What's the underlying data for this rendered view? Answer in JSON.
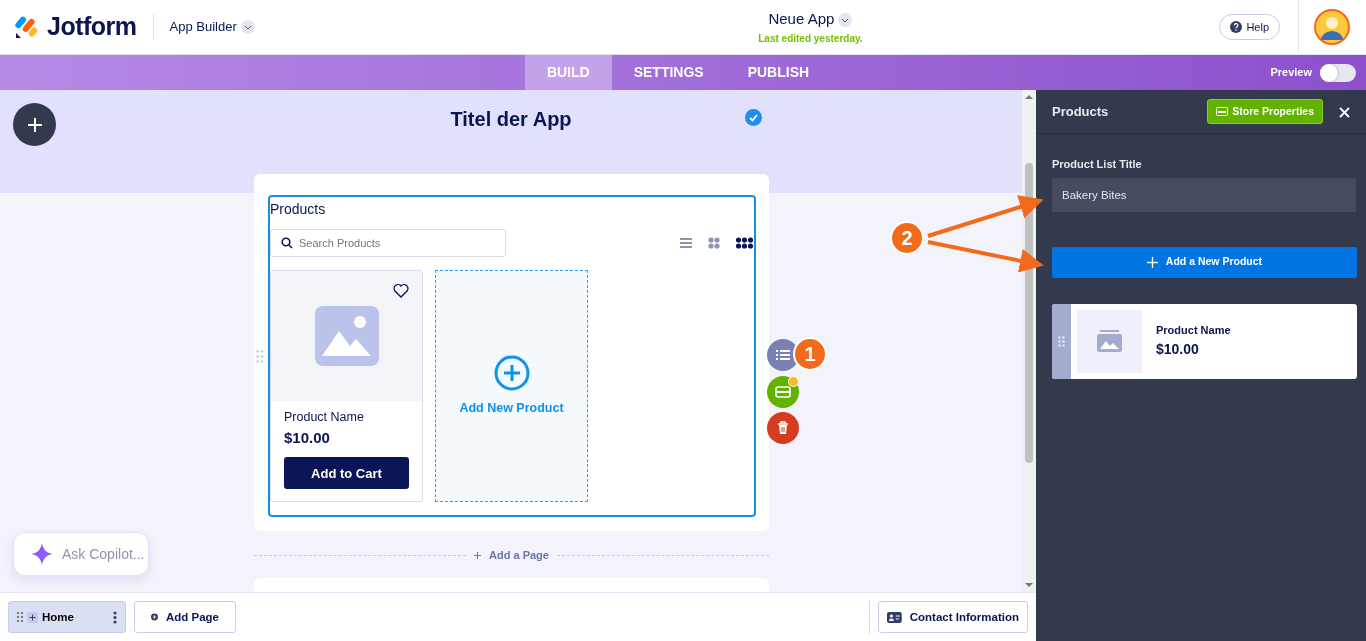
{
  "header": {
    "brand": "Jotform",
    "product_menu": "App Builder",
    "app_name": "Neue App",
    "last_edited": "Last edited yesterday.",
    "help": "Help"
  },
  "tabs": [
    {
      "label": "BUILD",
      "selected": true
    },
    {
      "label": "SETTINGS",
      "selected": false
    },
    {
      "label": "PUBLISH",
      "selected": false
    }
  ],
  "preview": {
    "label": "Preview",
    "on": false
  },
  "app": {
    "title": "Titel der App"
  },
  "product_list": {
    "title": "Products",
    "search_placeholder": "Search Products",
    "view_modes": [
      {
        "kind": "list",
        "selected": false
      },
      {
        "kind": "grid2",
        "selected": false
      },
      {
        "kind": "grid3",
        "selected": true
      }
    ],
    "products": [
      {
        "name": "Product Name",
        "price": "$10.00",
        "button": "Add to Cart",
        "favorite": false
      }
    ],
    "add_product": "Add New Product"
  },
  "add_page_divider": "Add a Page",
  "copilot": {
    "placeholder": "Ask Copilot..."
  },
  "pages": [
    {
      "label": "Home",
      "selected": true
    }
  ],
  "add_page": "Add Page",
  "contact_button": "Contact Information",
  "panel": {
    "title": "Products",
    "store_button": "Store Properties",
    "field_label": "Product List Title",
    "field_value": "Bakery Bites",
    "add_button": "Add a New Product",
    "items": [
      {
        "name": "Product Name",
        "price": "$10.00"
      }
    ]
  },
  "callouts": [
    "1",
    "2"
  ]
}
